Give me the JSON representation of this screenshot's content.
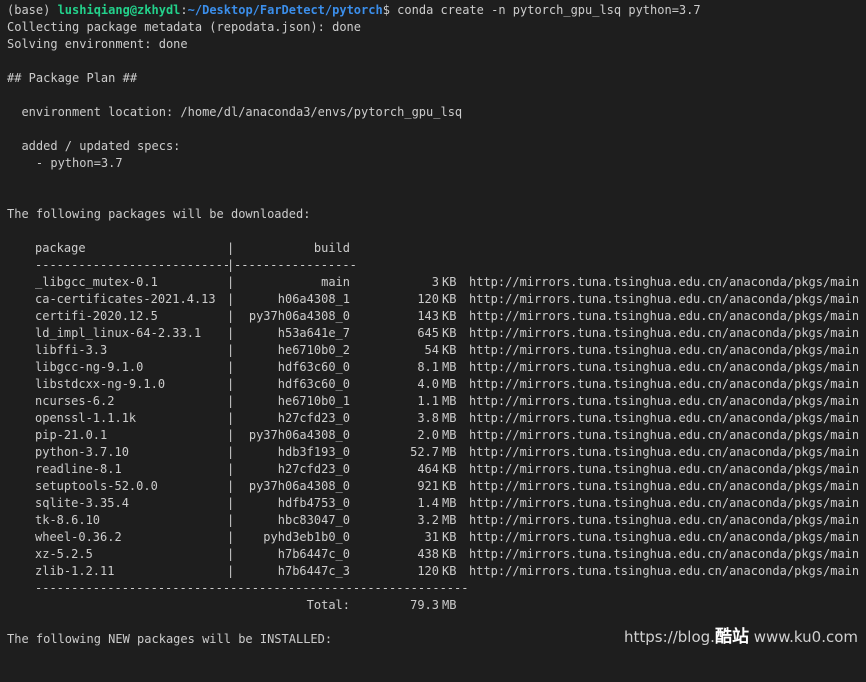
{
  "prompt": {
    "env": "(base) ",
    "user": "lushiqiang@zkhydl",
    "sep": ":",
    "path": "~/Desktop/FarDetect/pytorch",
    "dollar": "$ ",
    "command": "conda create -n pytorch_gpu_lsq python=3.7"
  },
  "lines": {
    "collecting": "Collecting package metadata (repodata.json): done",
    "solving": "Solving environment: done",
    "plan_header": "## Package Plan ##",
    "env_location": "  environment location: /home/dl/anaconda3/envs/pytorch_gpu_lsq",
    "added_specs": "  added / updated specs:",
    "spec_python": "    - python=3.7",
    "download_header": "The following packages will be downloaded:",
    "install_header": "The following NEW packages will be INSTALLED:"
  },
  "table": {
    "header_package": "package",
    "header_sep": "|",
    "header_build": "build",
    "divider_left": "---------------------------",
    "divider_pipe": "|",
    "divider_right": "-----------------",
    "rows": [
      {
        "name": "_libgcc_mutex-0.1",
        "build": "main",
        "size": "3",
        "unit": "KB",
        "url": "http://mirrors.tuna.tsinghua.edu.cn/anaconda/pkgs/main"
      },
      {
        "name": "ca-certificates-2021.4.13",
        "build": "h06a4308_1",
        "size": "120",
        "unit": "KB",
        "url": "http://mirrors.tuna.tsinghua.edu.cn/anaconda/pkgs/main"
      },
      {
        "name": "certifi-2020.12.5",
        "build": "py37h06a4308_0",
        "size": "143",
        "unit": "KB",
        "url": "http://mirrors.tuna.tsinghua.edu.cn/anaconda/pkgs/main"
      },
      {
        "name": "ld_impl_linux-64-2.33.1",
        "build": "h53a641e_7",
        "size": "645",
        "unit": "KB",
        "url": "http://mirrors.tuna.tsinghua.edu.cn/anaconda/pkgs/main"
      },
      {
        "name": "libffi-3.3",
        "build": "he6710b0_2",
        "size": "54",
        "unit": "KB",
        "url": "http://mirrors.tuna.tsinghua.edu.cn/anaconda/pkgs/main"
      },
      {
        "name": "libgcc-ng-9.1.0",
        "build": "hdf63c60_0",
        "size": "8.1",
        "unit": "MB",
        "url": "http://mirrors.tuna.tsinghua.edu.cn/anaconda/pkgs/main"
      },
      {
        "name": "libstdcxx-ng-9.1.0",
        "build": "hdf63c60_0",
        "size": "4.0",
        "unit": "MB",
        "url": "http://mirrors.tuna.tsinghua.edu.cn/anaconda/pkgs/main"
      },
      {
        "name": "ncurses-6.2",
        "build": "he6710b0_1",
        "size": "1.1",
        "unit": "MB",
        "url": "http://mirrors.tuna.tsinghua.edu.cn/anaconda/pkgs/main"
      },
      {
        "name": "openssl-1.1.1k",
        "build": "h27cfd23_0",
        "size": "3.8",
        "unit": "MB",
        "url": "http://mirrors.tuna.tsinghua.edu.cn/anaconda/pkgs/main"
      },
      {
        "name": "pip-21.0.1",
        "build": "py37h06a4308_0",
        "size": "2.0",
        "unit": "MB",
        "url": "http://mirrors.tuna.tsinghua.edu.cn/anaconda/pkgs/main"
      },
      {
        "name": "python-3.7.10",
        "build": "hdb3f193_0",
        "size": "52.7",
        "unit": "MB",
        "url": "http://mirrors.tuna.tsinghua.edu.cn/anaconda/pkgs/main"
      },
      {
        "name": "readline-8.1",
        "build": "h27cfd23_0",
        "size": "464",
        "unit": "KB",
        "url": "http://mirrors.tuna.tsinghua.edu.cn/anaconda/pkgs/main"
      },
      {
        "name": "setuptools-52.0.0",
        "build": "py37h06a4308_0",
        "size": "921",
        "unit": "KB",
        "url": "http://mirrors.tuna.tsinghua.edu.cn/anaconda/pkgs/main"
      },
      {
        "name": "sqlite-3.35.4",
        "build": "hdfb4753_0",
        "size": "1.4",
        "unit": "MB",
        "url": "http://mirrors.tuna.tsinghua.edu.cn/anaconda/pkgs/main"
      },
      {
        "name": "tk-8.6.10",
        "build": "hbc83047_0",
        "size": "3.2",
        "unit": "MB",
        "url": "http://mirrors.tuna.tsinghua.edu.cn/anaconda/pkgs/main"
      },
      {
        "name": "wheel-0.36.2",
        "build": "pyhd3eb1b0_0",
        "size": "31",
        "unit": "KB",
        "url": "http://mirrors.tuna.tsinghua.edu.cn/anaconda/pkgs/main"
      },
      {
        "name": "xz-5.2.5",
        "build": "h7b6447c_0",
        "size": "438",
        "unit": "KB",
        "url": "http://mirrors.tuna.tsinghua.edu.cn/anaconda/pkgs/main"
      },
      {
        "name": "zlib-1.2.11",
        "build": "h7b6447c_3",
        "size": "120",
        "unit": "KB",
        "url": "http://mirrors.tuna.tsinghua.edu.cn/anaconda/pkgs/main"
      }
    ],
    "footer_divider": "------------------------------------------------------------",
    "total_label": "Total:",
    "total_size": "79.3",
    "total_unit": "MB"
  },
  "watermark": {
    "prefix": "https://blog.",
    "brand": "酷站",
    "suffix": " www.ku0.com"
  },
  "colors": {
    "background": "#1e1e1e",
    "text": "#cccccc",
    "prompt_user": "#23d18b",
    "prompt_path": "#3b8eea"
  }
}
